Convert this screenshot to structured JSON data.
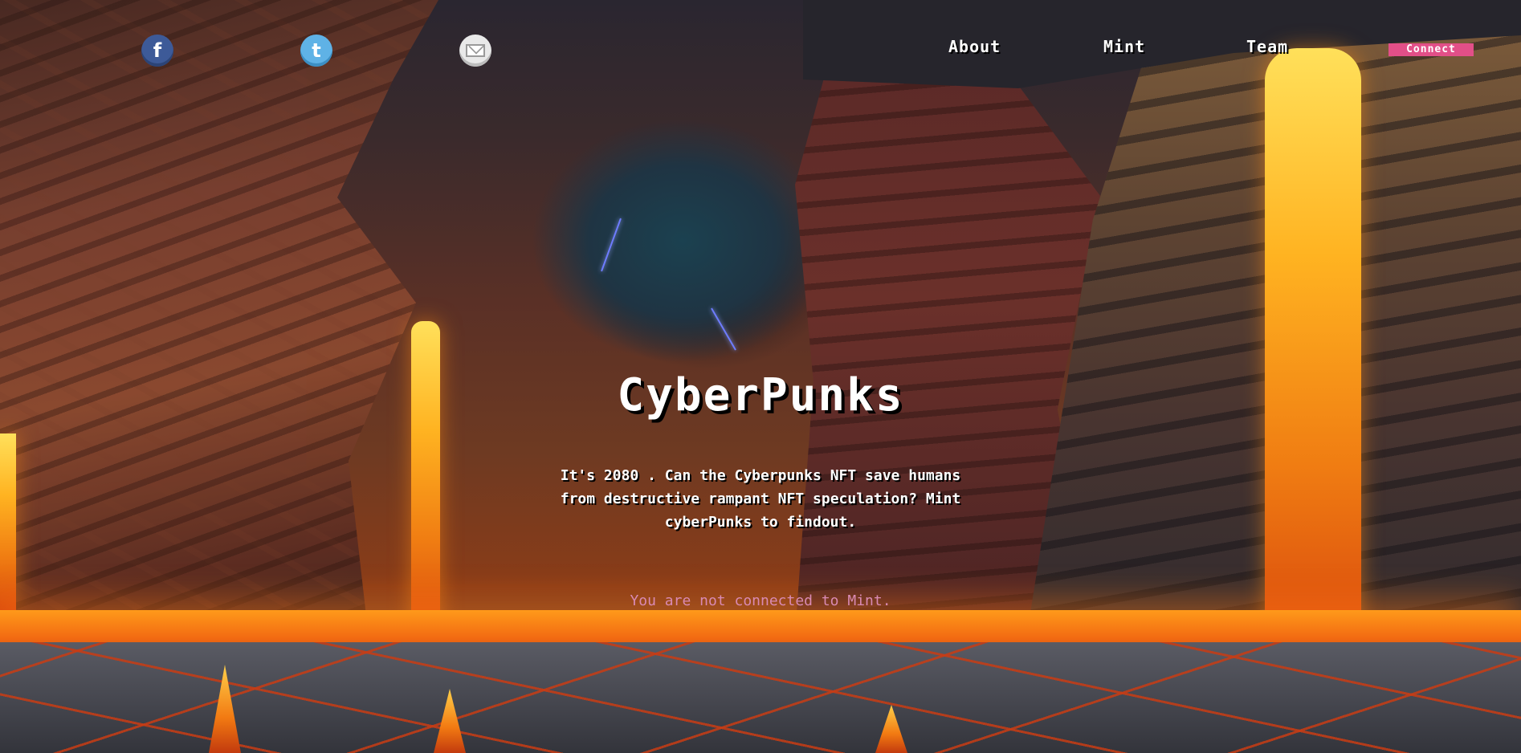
{
  "social": {
    "facebook_glyph": "f",
    "twitter_glyph": "t",
    "mail_icon": "envelope-icon",
    "facebook_color": "#3d5a98",
    "twitter_color": "#5fb2e6",
    "mail_color": "#e9e9e9"
  },
  "nav": {
    "about_label": "About",
    "mint_label": "Mint",
    "team_label": "Team",
    "connect_label": "Connect",
    "connect_color": "#e24f88"
  },
  "hero": {
    "title": "CyberPunks",
    "description": "It's 2080 . Can the Cyberpunks NFT save humans from destructive rampant NFT speculation? Mint cyberPunks to findout.",
    "status": "You are not connected to Mint."
  }
}
